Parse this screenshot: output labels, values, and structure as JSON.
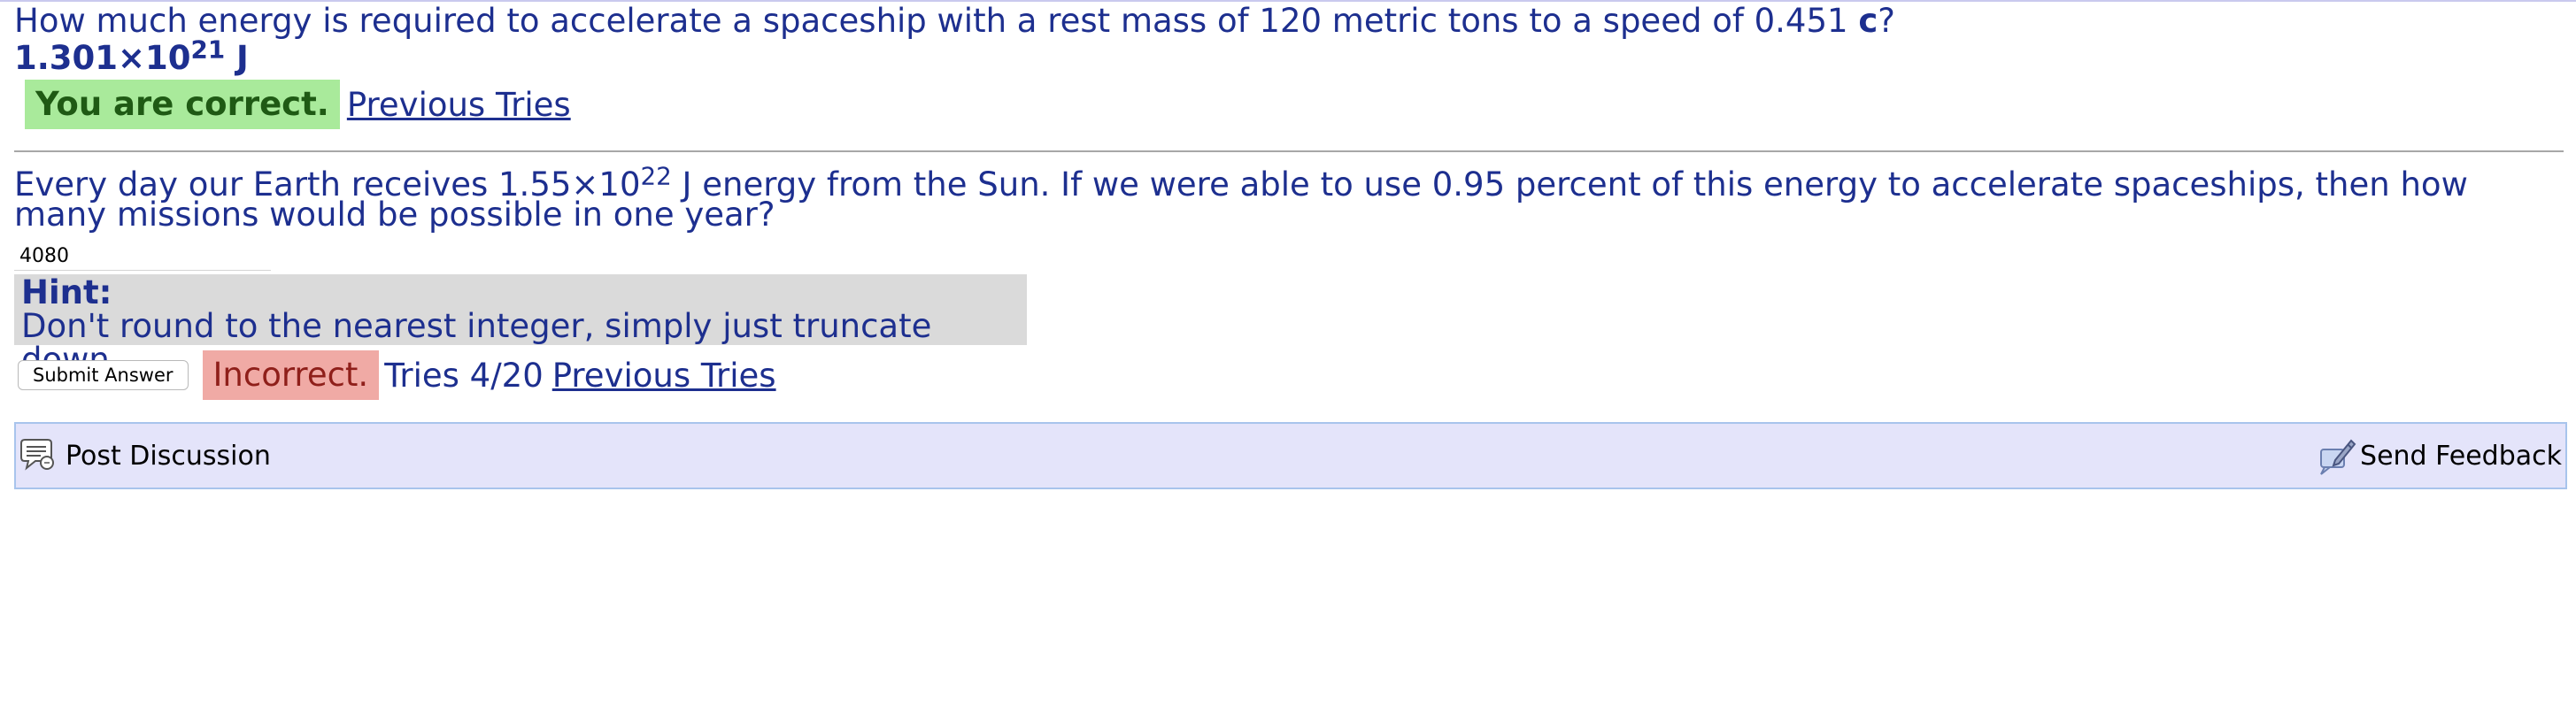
{
  "question1": {
    "text_before": "How much energy is required to accelerate a spaceship with a rest mass of 120 metric tons to a speed of 0.451 ",
    "text_bold": "c",
    "text_after": "?"
  },
  "answer1": {
    "mantissa": "1.301×10",
    "exponent": "21",
    "unit": " J"
  },
  "feedback1": {
    "status": "You are correct.",
    "previous_tries_link": "Previous Tries",
    "status_color": "#a9ea9b"
  },
  "question2": {
    "text_before": "Every day our Earth receives 1.55×10",
    "exponent": "22",
    "text_after": " J energy from the Sun. If we were able to use 0.95 percent of this energy to accelerate spaceships, then how many missions would be possible in one year?"
  },
  "answer2_input": {
    "value": "4080"
  },
  "hint": {
    "title": "Hint:",
    "text": "Don't round to the nearest integer, simply just truncate down."
  },
  "feedback2": {
    "submit_label": "Submit Answer",
    "status": "Incorrect.",
    "tries": "Tries 4/20",
    "previous_tries_link": "Previous Tries",
    "status_color": "#f0aaa5"
  },
  "discussion_bar": {
    "post_discussion_label": "Post Discussion",
    "post_discussion_icon": "speech-bubble-icon",
    "send_feedback_label": "Send Feedback",
    "send_feedback_icon": "feedback-pen-icon",
    "background_color": "#e4e4fa"
  },
  "colors": {
    "text": "#1d2f8f",
    "divider": "#a7a7a7"
  }
}
